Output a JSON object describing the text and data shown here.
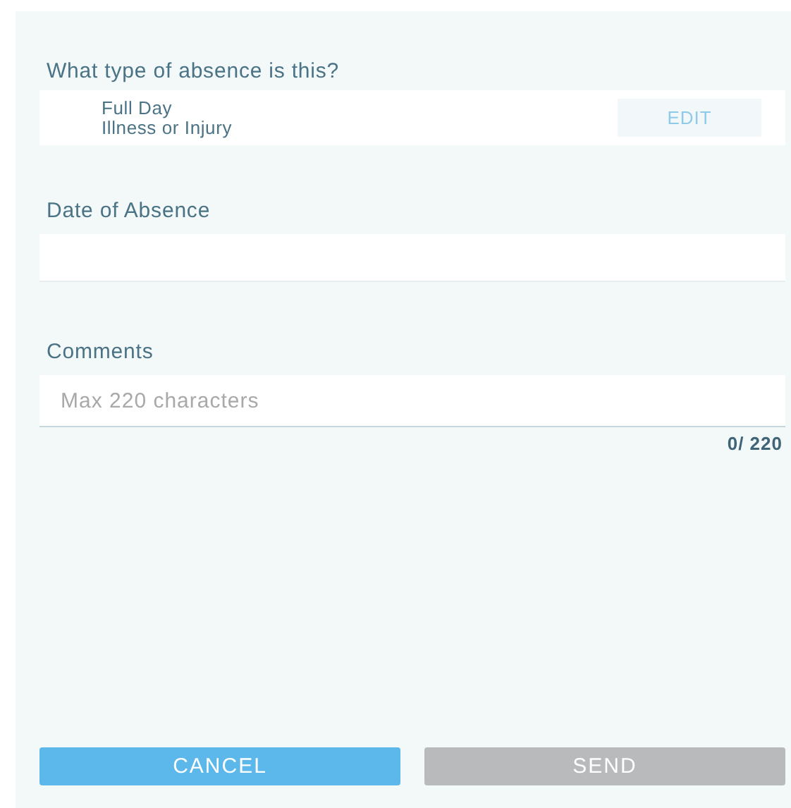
{
  "absence_type": {
    "label": "What type of absence is this?",
    "duration": "Full Day",
    "reason": "Illness or Injury",
    "edit_button": "EDIT"
  },
  "date": {
    "label": "Date of Absence"
  },
  "comments": {
    "label": "Comments",
    "placeholder": "Max 220 characters",
    "counter": "0/ 220"
  },
  "buttons": [
    {
      "label": "CANCEL",
      "disabled": false
    },
    {
      "label": "SEND",
      "disabled": true
    }
  ]
}
